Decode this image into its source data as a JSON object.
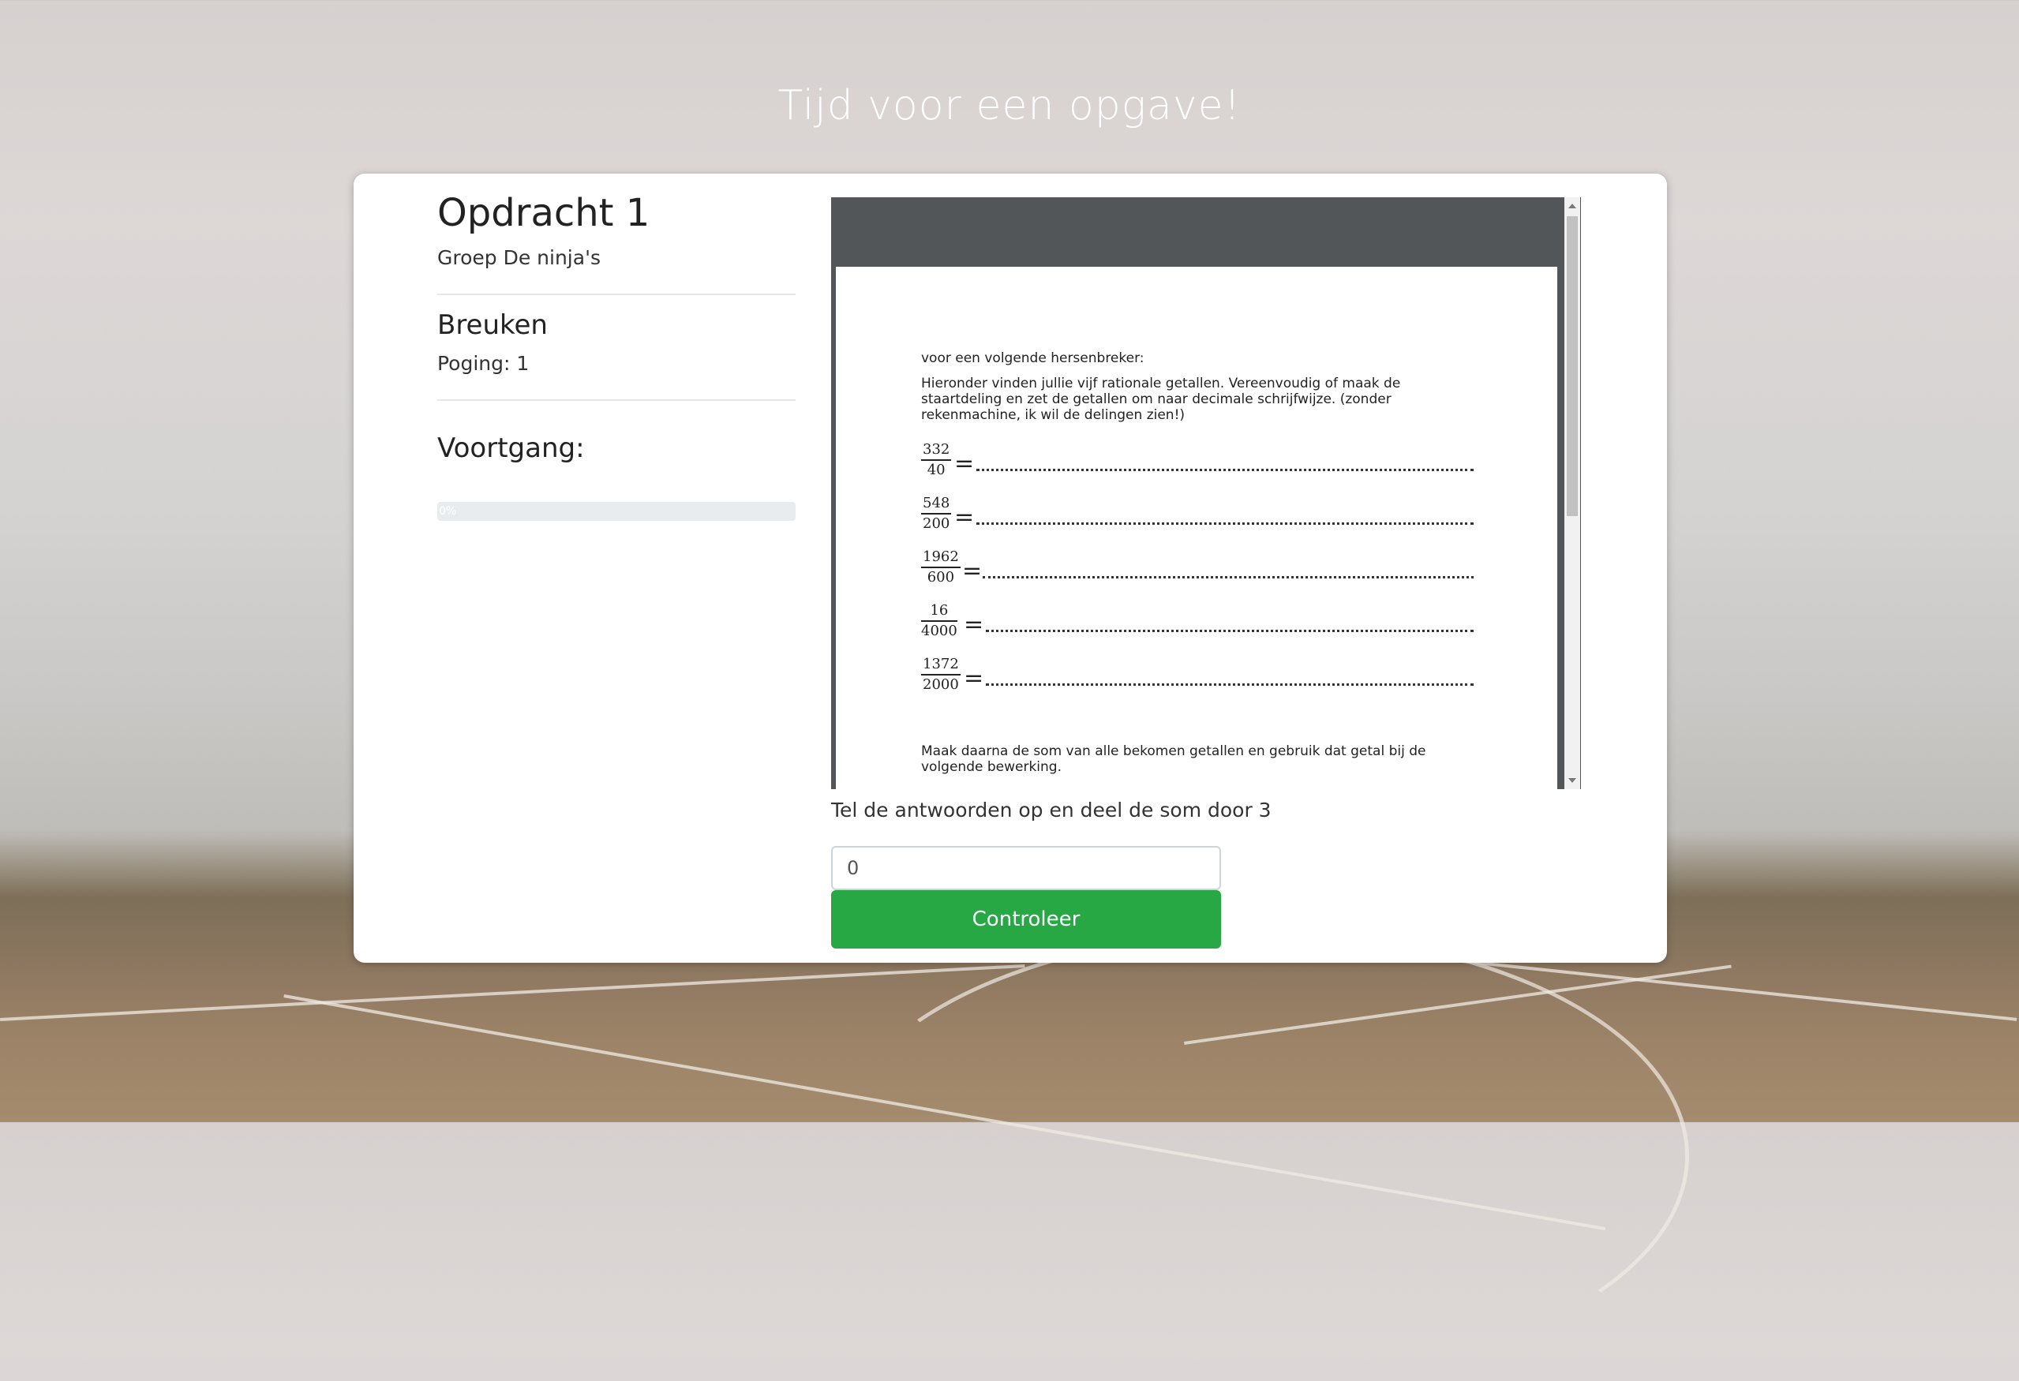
{
  "page": {
    "heading": "Tijd voor een opgave!"
  },
  "assignment": {
    "title": "Opdracht 1",
    "group": "Groep De ninja's",
    "subject": "Breuken",
    "attempt": "Poging: 1",
    "progress_title": "Voortgang:",
    "progress_label": "0%",
    "progress_percent": 0
  },
  "document": {
    "intro": "voor een volgende hersenbreker:",
    "instructions": "Hieronder vinden jullie vijf rationale getallen. Vereenvoudig of maak de staartdeling en zet de getallen om naar decimale schrijfwijze. (zonder rekenmachine, ik wil de delingen zien!)",
    "fractions": [
      {
        "numerator": "332",
        "denominator": "40",
        "equals": "="
      },
      {
        "numerator": "548",
        "denominator": "200",
        "equals": "="
      },
      {
        "numerator": "1962",
        "denominator": "600",
        "equals": "="
      },
      {
        "numerator": "16",
        "denominator": "4000",
        "equals": "="
      },
      {
        "numerator": "1372",
        "denominator": "2000",
        "equals": "="
      }
    ],
    "closing": "Maak daarna de som van alle bekomen getallen en gebruik dat getal bij de volgende bewerking."
  },
  "form": {
    "instruction": "Tel de antwoorden op en deel de som door 3",
    "answer_value": "0",
    "submit_label": "Controleer"
  }
}
